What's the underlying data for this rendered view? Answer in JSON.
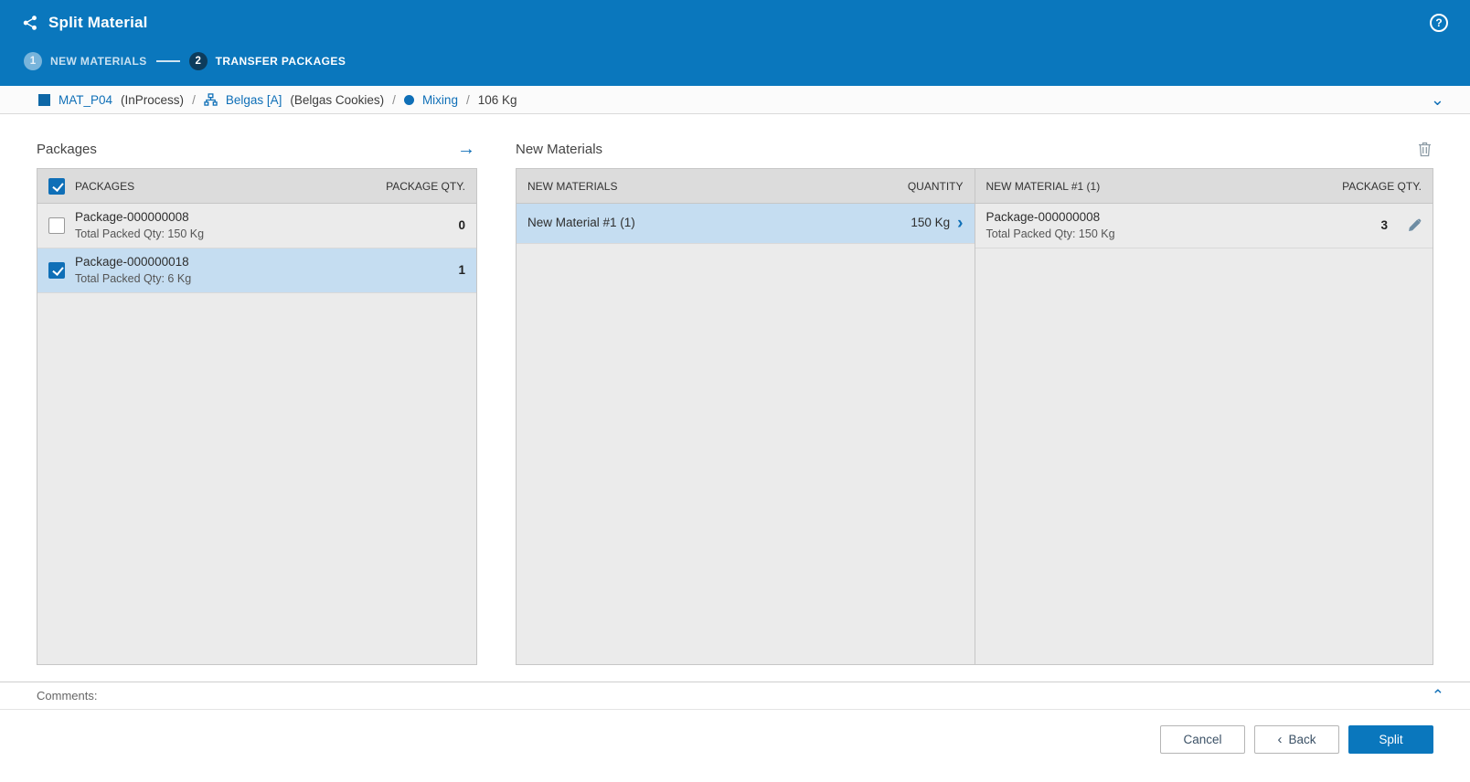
{
  "colors": {
    "primary": "#0a77bd",
    "selected_row": "#c5ddf1",
    "link": "#0f6fb7"
  },
  "icons": {
    "help": "?",
    "arrow_right": "→",
    "chevron_down": "⌄",
    "chevron_up": "⌃",
    "chevron_right": "›",
    "back_chevron": "‹"
  },
  "header": {
    "title": "Split Material"
  },
  "steps": {
    "step1": {
      "number": "1",
      "label": "NEW MATERIALS",
      "state": "done"
    },
    "step2": {
      "number": "2",
      "label": "TRANSFER PACKAGES",
      "state": "active"
    }
  },
  "breadcrumb": {
    "material": "MAT_P04",
    "material_status": "(InProcess)",
    "sep1": "/",
    "equipment": "Belgas [A]",
    "equipment_desc": "(Belgas Cookies)",
    "sep2": "/",
    "operation": "Mixing",
    "sep3": "/",
    "quantity": "106 Kg"
  },
  "packages_panel": {
    "title": "Packages",
    "col_packages": "PACKAGES",
    "col_qty": "PACKAGE QTY.",
    "header_checked": true,
    "rows": [
      {
        "name": "Package-000000008",
        "detail": "Total Packed Qty: 150 Kg",
        "qty": "0",
        "checked": false,
        "selected": false
      },
      {
        "name": "Package-000000018",
        "detail": "Total Packed Qty: 6 Kg",
        "qty": "1",
        "checked": true,
        "selected": true
      }
    ]
  },
  "new_materials_panel": {
    "title": "New Materials",
    "materials_table": {
      "col_name": "NEW MATERIALS",
      "col_quantity": "QUANTITY",
      "rows": [
        {
          "name": "New Material #1 (1)",
          "quantity": "150 Kg",
          "selected": true
        }
      ]
    },
    "packages_table": {
      "col_name": "NEW MATERIAL #1 (1)",
      "col_qty": "PACKAGE QTY.",
      "rows": [
        {
          "name": "Package-000000008",
          "detail": "Total Packed Qty: 150 Kg",
          "qty": "3"
        }
      ]
    }
  },
  "comments": {
    "label": "Comments:"
  },
  "footer": {
    "cancel_label": "Cancel",
    "back_label": "Back",
    "split_label": "Split"
  }
}
